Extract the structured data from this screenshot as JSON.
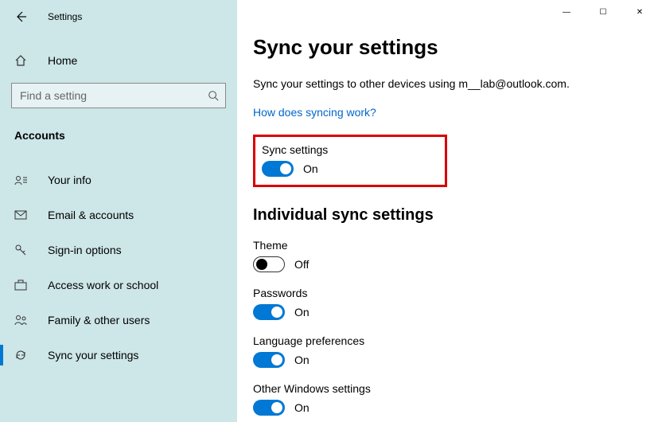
{
  "app_title": "Settings",
  "window_controls": {
    "minimize": "—",
    "maximize": "☐",
    "close": "✕"
  },
  "home_label": "Home",
  "search": {
    "placeholder": "Find a setting"
  },
  "category": "Accounts",
  "nav": [
    {
      "label": "Your info"
    },
    {
      "label": "Email & accounts"
    },
    {
      "label": "Sign-in options"
    },
    {
      "label": "Access work or school"
    },
    {
      "label": "Family & other users"
    },
    {
      "label": "Sync your settings"
    }
  ],
  "page": {
    "title": "Sync your settings",
    "description": "Sync your settings to other devices using m__lab@outlook.com.",
    "help_link": "How does syncing work?",
    "sync_settings": {
      "label": "Sync settings",
      "state": "On"
    },
    "individual_title": "Individual sync settings",
    "items": [
      {
        "label": "Theme",
        "state": "Off"
      },
      {
        "label": "Passwords",
        "state": "On"
      },
      {
        "label": "Language preferences",
        "state": "On"
      },
      {
        "label": "Other Windows settings",
        "state": "On"
      }
    ]
  }
}
